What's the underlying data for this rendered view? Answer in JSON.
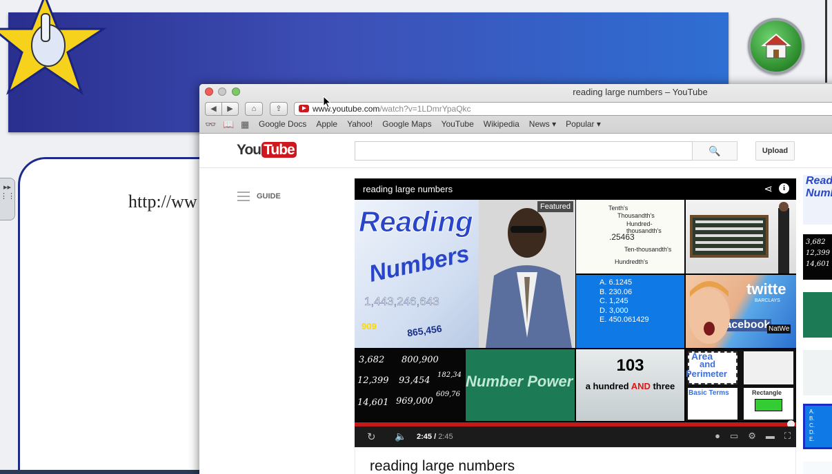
{
  "background_app": {
    "url_fragment": "http://ww"
  },
  "browser": {
    "window_title": "reading large numbers – YouTube",
    "address": {
      "host": "www.youtube.com",
      "path": "/watch?v=1LDmrYpaQkc"
    },
    "bookmarks": [
      "Google Docs",
      "Apple",
      "Yahoo!",
      "Google Maps",
      "YouTube",
      "Wikipedia",
      "News ▾",
      "Popular ▾"
    ]
  },
  "youtube": {
    "logo_you": "You",
    "logo_tube": "Tube",
    "search_placeholder": "",
    "upload_label": "Upload",
    "guide_label": "GUIDE",
    "player": {
      "title": "reading large numbers",
      "featured_badge": "Featured",
      "time_current": "2:45",
      "time_duration": "2:45",
      "progress": 1.0
    },
    "tiles": {
      "main_word1": "Reading",
      "main_word2": "Numbers",
      "main_num1": "1,443,246,643",
      "main_num2": "909",
      "main_num3": "865,456",
      "place_value": [
        "Tenth's",
        "Thousandth's",
        "Hundred-thousandth's",
        ".25463",
        "Ten-thousandth's",
        "Hundredth's"
      ],
      "quiz": [
        "A. 6.1245",
        "B. 230.06",
        "C. 1,245",
        "D. 3,000",
        "E. 450.061429"
      ],
      "handwriting": [
        "3,682",
        "800,900",
        "12,399",
        "93,454",
        "14,601",
        "969,000",
        "182,34",
        "609,76"
      ],
      "power": "Number Power",
      "num_big": "103",
      "num_words_pre": "a hundred ",
      "num_words_and": "AND",
      "num_words_post": " three",
      "area_words": [
        "Area",
        "and",
        "Perimeter",
        "Basic Terms",
        "Rectangle"
      ],
      "face_words": [
        "twitte",
        "facebook",
        "NatWe",
        "BARCLAYS"
      ]
    },
    "video_title": "reading large numbers",
    "sidebar": {
      "side1": "Read Numb",
      "side2": [
        "3,682",
        "12,399",
        "14,601"
      ],
      "side5": [
        "A.",
        "B.",
        "C.",
        "D.",
        "E."
      ]
    }
  }
}
